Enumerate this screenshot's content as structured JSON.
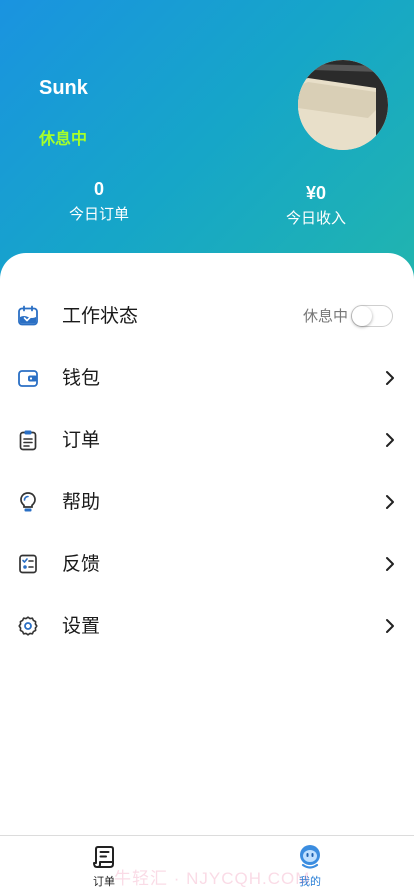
{
  "profile": {
    "username": "Sunk",
    "status": "休息中"
  },
  "stats": {
    "orders": {
      "value": "0",
      "label": "今日订单"
    },
    "income": {
      "value": "¥0",
      "label": "今日收入"
    }
  },
  "menu": {
    "work_status": {
      "label": "工作状态",
      "toggle_label": "休息中",
      "toggle_on": false,
      "icon": "calendar-icon"
    },
    "wallet": {
      "label": "钱包",
      "icon": "wallet-icon"
    },
    "orders": {
      "label": "订单",
      "icon": "clipboard-icon"
    },
    "help": {
      "label": "帮助",
      "icon": "lightbulb-icon"
    },
    "feedback": {
      "label": "反馈",
      "icon": "checklist-icon"
    },
    "settings": {
      "label": "设置",
      "icon": "gear-icon"
    }
  },
  "tabbar": {
    "orders": {
      "label": "订单",
      "icon": "receipt-icon"
    },
    "mine": {
      "label": "我的",
      "icon": "robot-face-icon",
      "active": true
    }
  },
  "watermark": "牛轻汇 · NJYCQH.COM",
  "colors": {
    "header_gradient_start": "#1a93e0",
    "header_gradient_end": "#21b5ae",
    "status_green": "#a6ff2a",
    "icon_blue": "#2a6fc4",
    "active_tab": "#2a7fd6"
  }
}
